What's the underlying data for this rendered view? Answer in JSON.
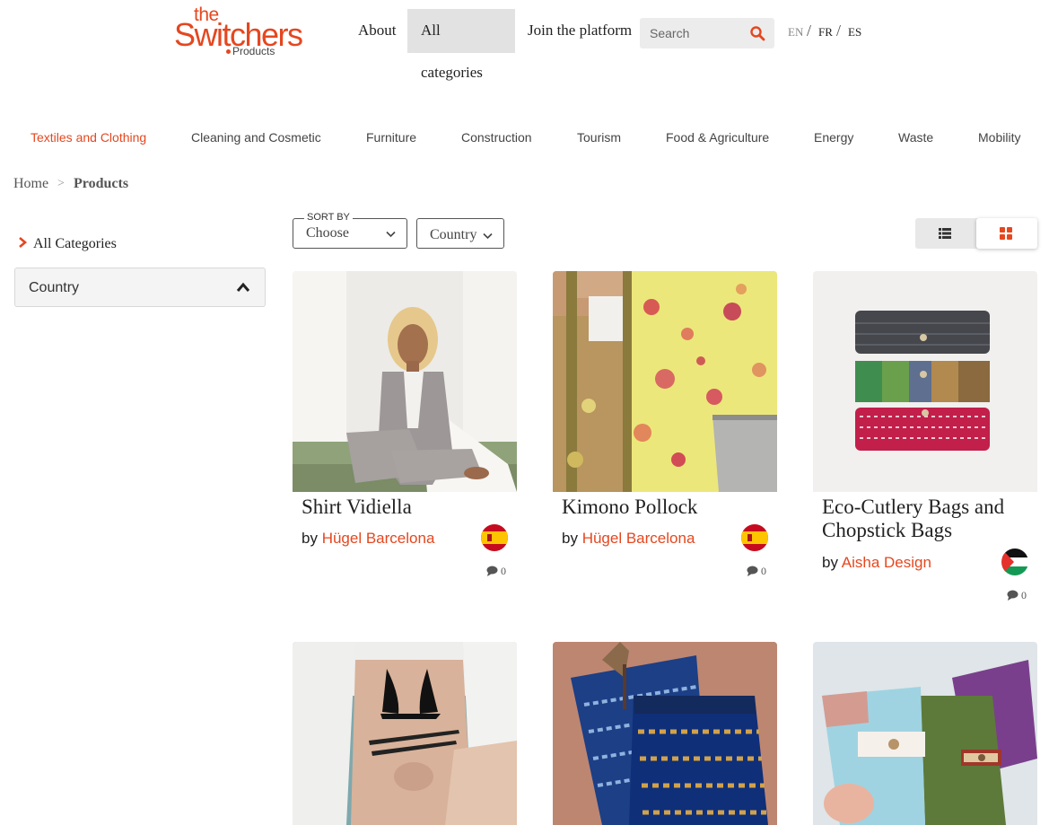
{
  "header": {
    "logo": {
      "the": "the",
      "name": "Switchers",
      "sub": "Products"
    },
    "nav": {
      "about": "About",
      "all_categories": "All categories",
      "join": "Join the platform"
    },
    "search": {
      "placeholder": "Search"
    },
    "languages": [
      "EN",
      "FR",
      "ES"
    ],
    "separator": "/"
  },
  "categories": [
    "Textiles and Clothing",
    "Cleaning and Cosmetic",
    "Furniture",
    "Construction",
    "Tourism",
    "Food & Agriculture",
    "Energy",
    "Waste",
    "Mobility"
  ],
  "breadcrumb": {
    "home": "Home",
    "separator": ">",
    "current": "Products"
  },
  "sidebar": {
    "all_categories": "All Categories",
    "country_filter": "Country"
  },
  "toolbar": {
    "sort_label": "SORT BY",
    "sort_value": "Choose",
    "country_value": "Country"
  },
  "products": [
    {
      "title": "Shirt Vidiella",
      "by": "by",
      "brand": "Hügel Barcelona",
      "flag": "Spain",
      "comments": "0"
    },
    {
      "title": "Kimono Pollock",
      "by": "by",
      "brand": "Hügel Barcelona",
      "flag": "Spain",
      "comments": "0"
    },
    {
      "title": "Eco-Cutlery Bags and Chopstick Bags",
      "by": "by",
      "brand": "Aisha Design",
      "flag": "Palestine",
      "comments": "0"
    },
    {
      "title": "",
      "by": "",
      "brand": "",
      "flag": "",
      "comments": ""
    },
    {
      "title": "",
      "by": "",
      "brand": "",
      "flag": "",
      "comments": ""
    },
    {
      "title": "",
      "by": "",
      "brand": "",
      "flag": "",
      "comments": ""
    }
  ],
  "colors": {
    "accent": "#e5471f",
    "nav_active_bg": "#e2e2e2"
  }
}
